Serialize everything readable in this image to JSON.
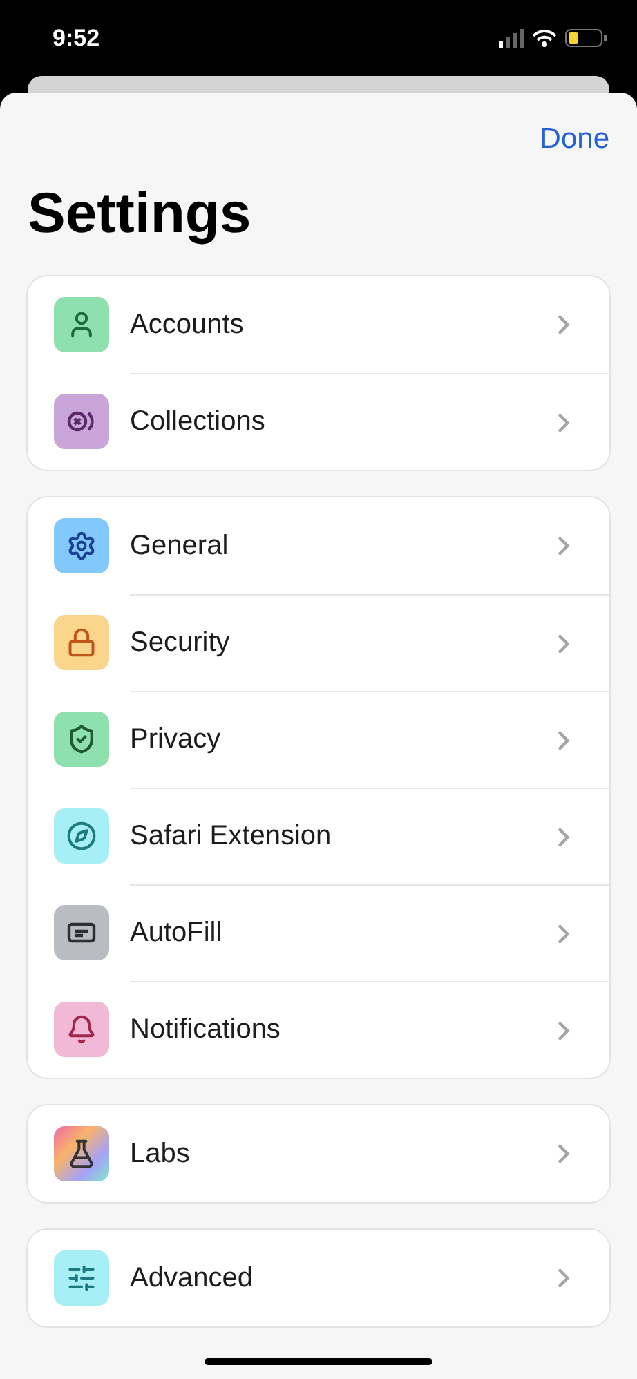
{
  "status_bar": {
    "time": "9:52"
  },
  "nav": {
    "done": "Done"
  },
  "title": "Settings",
  "groups": [
    {
      "items": [
        {
          "label": "Accounts",
          "kind": "solid",
          "color": "#8ee0ae"
        },
        {
          "label": "Collections",
          "kind": "solid",
          "color": "#c9a5d9"
        }
      ]
    },
    {
      "items": [
        {
          "label": "General",
          "kind": "solid",
          "color": "#83c8fb"
        },
        {
          "label": "Security",
          "kind": "solid",
          "color": "#f9d68c"
        },
        {
          "label": "Privacy",
          "kind": "solid",
          "color": "#8ee0ae"
        },
        {
          "label": "Safari Extension",
          "kind": "solid",
          "color": "#a6eff5"
        },
        {
          "label": "AutoFill",
          "kind": "solid",
          "color": "#b9bcc1"
        },
        {
          "label": "Notifications",
          "kind": "solid",
          "color": "#f1b9d6"
        }
      ]
    },
    {
      "items": [
        {
          "label": "Labs",
          "kind": "gradient"
        }
      ]
    },
    {
      "items": [
        {
          "label": "Advanced",
          "kind": "solid",
          "color": "#a6eff5"
        }
      ]
    }
  ]
}
